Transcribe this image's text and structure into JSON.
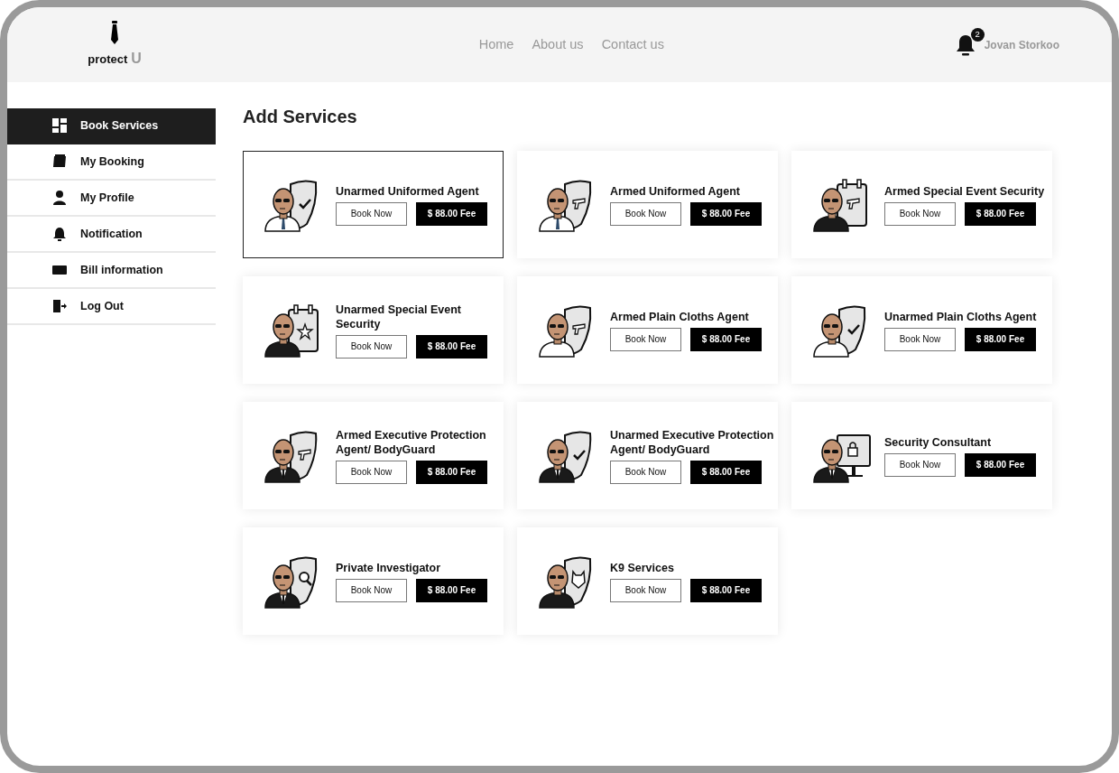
{
  "header": {
    "logo": {
      "word": "protect",
      "letter": "U"
    },
    "nav": [
      "Home",
      "About us",
      "Contact us"
    ],
    "notifications": {
      "count": "2"
    },
    "user": "Jovan Storkoo"
  },
  "sidebar": {
    "items": [
      {
        "label": "Book Services",
        "kind": "grid",
        "selected": true
      },
      {
        "label": "My Booking",
        "kind": "book",
        "selected": false
      },
      {
        "label": "My Profile",
        "kind": "person",
        "selected": false
      },
      {
        "label": "Notification",
        "kind": "bell",
        "selected": false
      },
      {
        "label": "Bill information",
        "kind": "card",
        "selected": false
      },
      {
        "label": "Log Out",
        "kind": "logout",
        "selected": false
      }
    ]
  },
  "main": {
    "title": "Add Services",
    "services": [
      {
        "name": "Unarmed Uniformed Agent",
        "book": "Book Now",
        "fee": "$ 88.00 Fee",
        "selected": true
      },
      {
        "name": "Armed Uniformed Agent",
        "book": "Book Now",
        "fee": "$ 88.00 Fee",
        "selected": false
      },
      {
        "name": "Armed Special Event Security",
        "book": "Book Now",
        "fee": "$ 88.00 Fee",
        "selected": false
      },
      {
        "name": "Unarmed Special Event Security",
        "book": "Book Now",
        "fee": "$ 88.00 Fee",
        "selected": false
      },
      {
        "name": "Armed Plain Cloths Agent",
        "book": "Book Now",
        "fee": "$ 88.00 Fee",
        "selected": false
      },
      {
        "name": "Unarmed Plain Cloths Agent",
        "book": "Book Now",
        "fee": "$ 88.00 Fee",
        "selected": false
      },
      {
        "name": "Armed Executive Protection Agent/ BodyGuard",
        "book": "Book Now",
        "fee": "$ 88.00 Fee",
        "selected": false
      },
      {
        "name": "Unarmed Executive Protection Agent/ BodyGuard",
        "book": "Book Now",
        "fee": "$ 88.00 Fee",
        "selected": false
      },
      {
        "name": "Security Consultant",
        "book": "Book Now",
        "fee": "$ 88.00 Fee",
        "selected": false
      },
      {
        "name": "Private Investigator",
        "book": "Book Now",
        "fee": "$ 88.00 Fee",
        "selected": false
      },
      {
        "name": "K9 Services",
        "book": "Book Now",
        "fee": "$ 88.00 Fee",
        "selected": false
      }
    ]
  }
}
